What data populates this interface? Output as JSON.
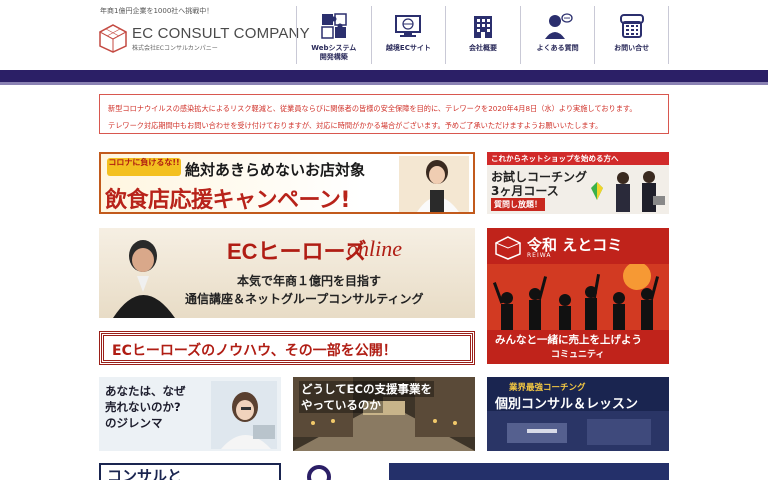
{
  "header": {
    "tagline": "年商1億円企業を1000社へ挑戦中！",
    "logo_title": "EC CONSULT COMPANY",
    "logo_sub": "株式会社ECコンサルカンパニー"
  },
  "nav": {
    "items": [
      {
        "label": "Webシステム\n開発構築",
        "icon": "puzzle-icon"
      },
      {
        "label": "越境ECサイト",
        "icon": "monitor-globe-icon"
      },
      {
        "label": "会社概要",
        "icon": "building-icon"
      },
      {
        "label": "よくある質問",
        "icon": "person-question-icon"
      },
      {
        "label": "お問い合せ",
        "icon": "phone-icon"
      }
    ]
  },
  "notice": {
    "line1": "新型コロナウイルスの感染拡大によるリスク軽減と、従業員ならびに関係者の皆様の安全保障を目的に、テレワークを2020年4月8日（水）より実施しております。",
    "line2": "テレワーク対応期間中もお問い合わせを受け付けておりますが、対応に時間がかかる場合がございます。予めご了承いただけますようお願いいたします。"
  },
  "banners": {
    "restaurant": {
      "badge": "コロナに負けるな!!",
      "line1": "絶対あきらめないお店対象",
      "line2": "飲食店応援キャンペーン!"
    },
    "trial": {
      "top": "これからネットショップを始める方へ",
      "t1": "お試しコーチング",
      "t2": "3ヶ月コース",
      "t3": "質問し放題！"
    },
    "heroes": {
      "title": "ECヒーローズ",
      "online": "online",
      "sub1": "本気で年商１億円を目指す",
      "sub2": "通信講座＆ネットグループコンサルティング"
    },
    "reiwa": {
      "title": "令和 えとコミ",
      "sub": "REIWA",
      "cap1": "みんなと一緒に売上を上げよう",
      "cap2": "コミュニティ"
    },
    "knowhow": {
      "text": "ECヒーローズのノウハウ、その一部を公開！"
    },
    "dilemma": {
      "l1": "あなたは、なぜ",
      "l2": "売れないのか?",
      "l3": "のジレンマ"
    },
    "why": {
      "l1": "どうしてECの支援事業を",
      "l2": "やっているのか"
    },
    "consult": {
      "pre": "業界最強コーチング",
      "main": "個別コンサル＆レッスン"
    },
    "bottom": {
      "text": "コンサルと"
    }
  },
  "colors": {
    "accent_purple": "#2b1f66",
    "notice_red": "#d0322a",
    "banner_red": "#b01d14"
  }
}
